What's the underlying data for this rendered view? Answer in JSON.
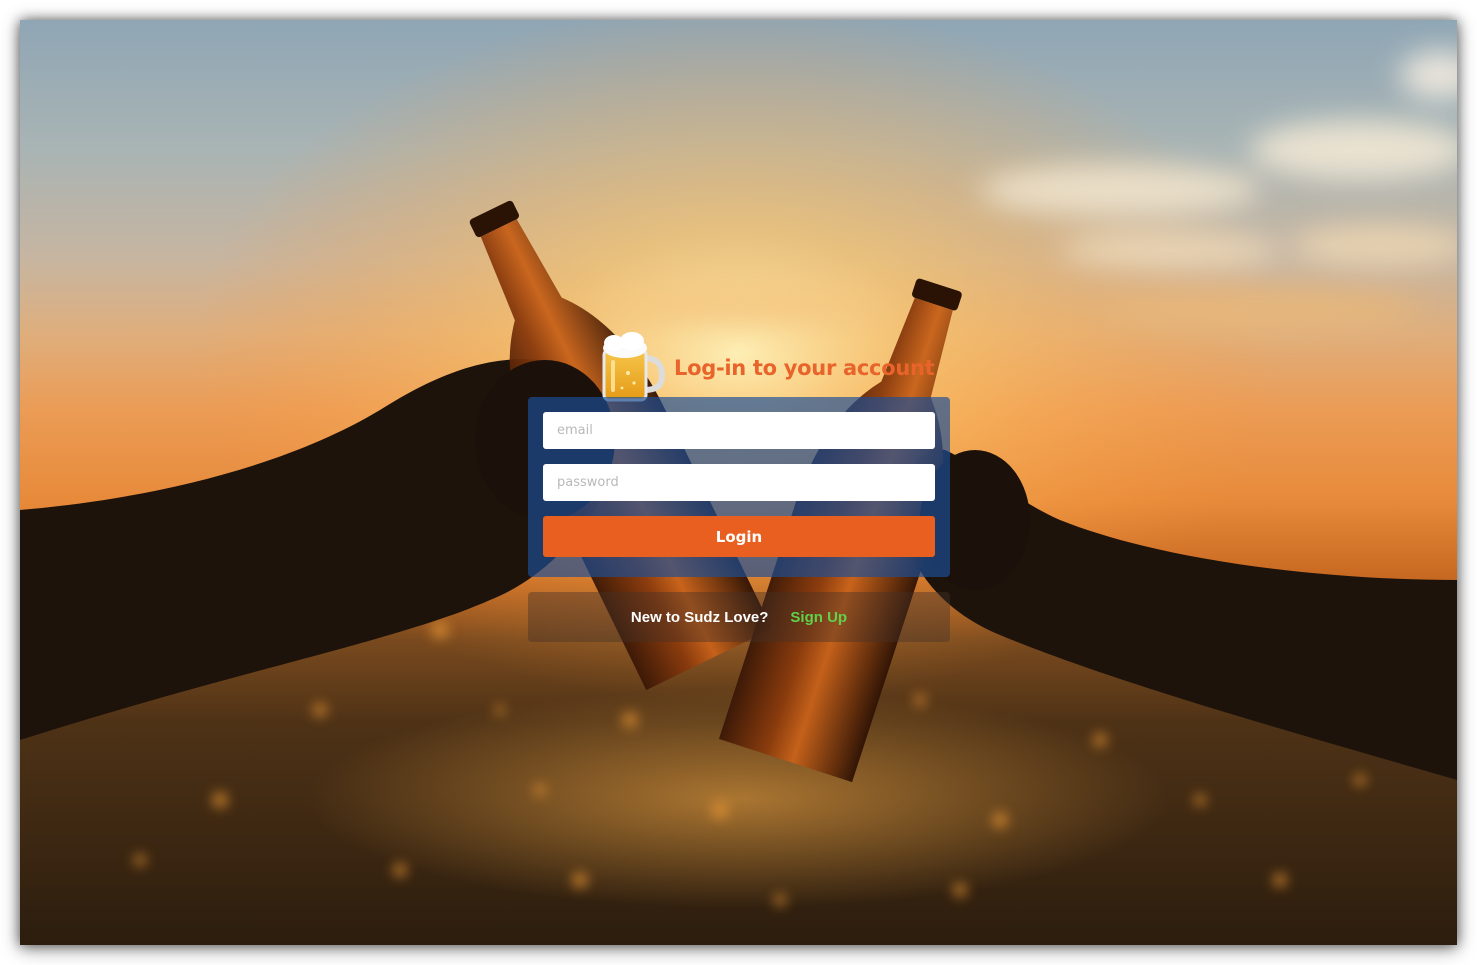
{
  "header": {
    "title": "Log-in to your account",
    "icon": "beer-mug-icon"
  },
  "form": {
    "email_placeholder": "email",
    "password_placeholder": "password",
    "login_label": "Login"
  },
  "signup": {
    "prompt": "New to Sudz Love?",
    "link_label": "Sign Up"
  },
  "colors": {
    "title": "#e8642a",
    "login_button": "#e95f20",
    "form_card": "#1c4e96",
    "signup_link": "#5fd14a"
  }
}
